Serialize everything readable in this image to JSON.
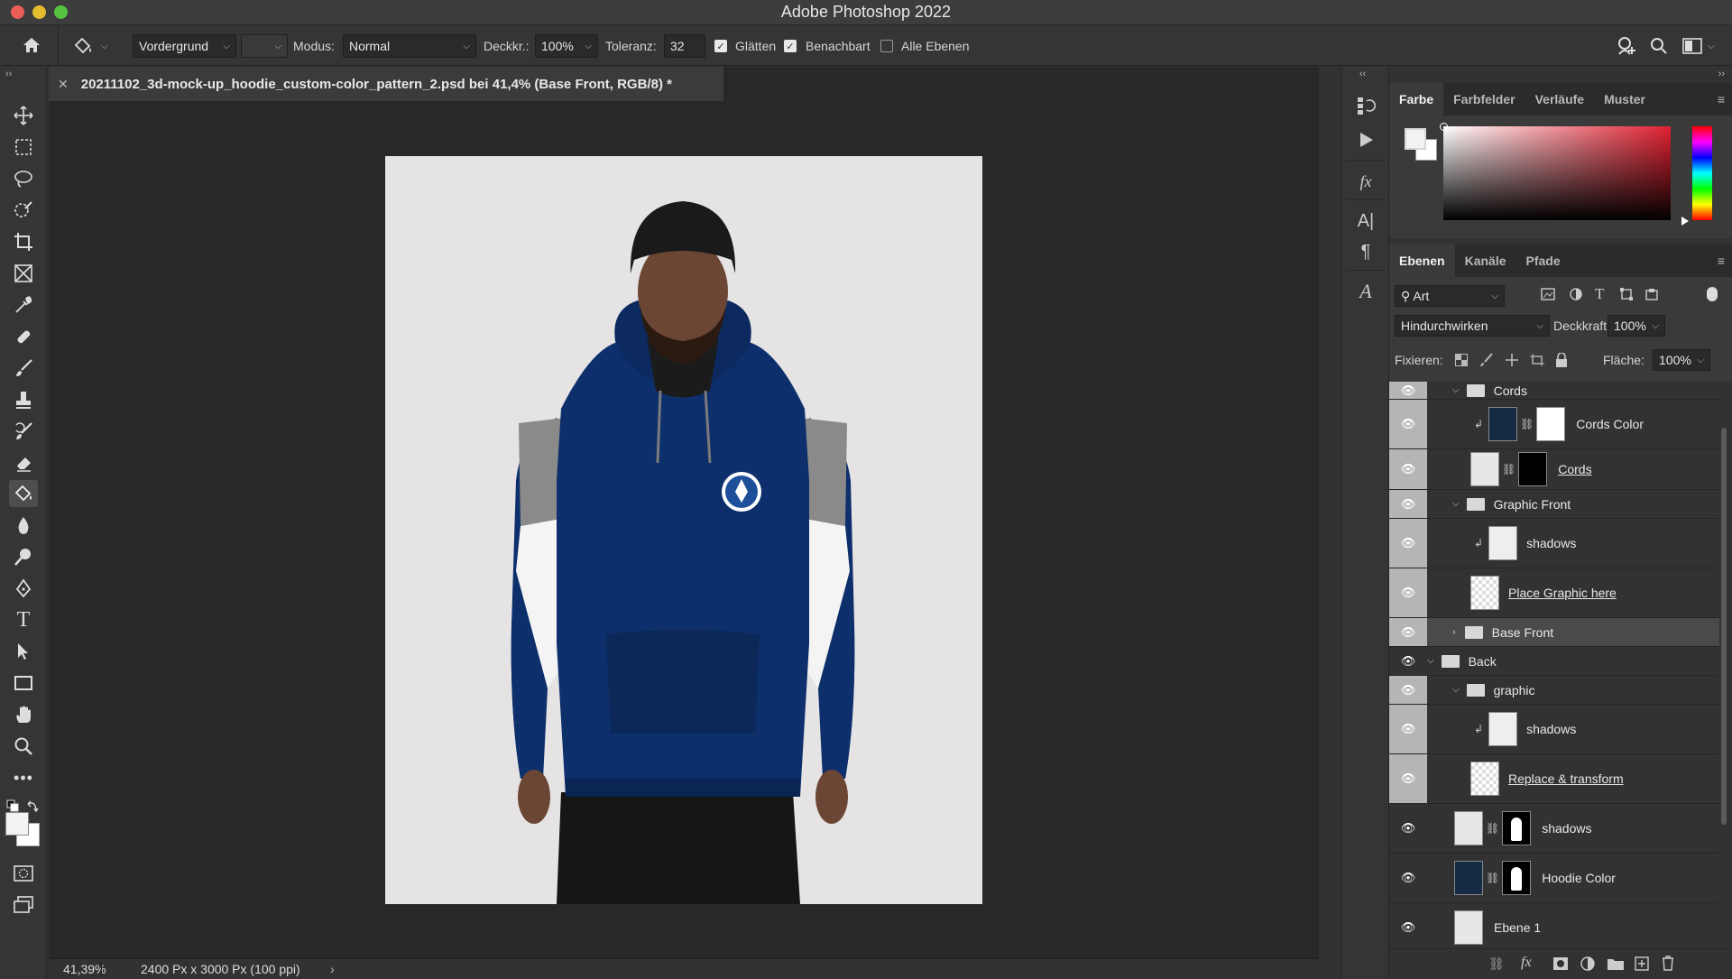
{
  "app": {
    "title": "Adobe Photoshop 2022"
  },
  "options": {
    "fill_source": "Vordergrund",
    "mode_label": "Modus:",
    "mode_value": "Normal",
    "opacity_label": "Deckkr.:",
    "opacity_value": "100%",
    "tolerance_label": "Toleranz:",
    "tolerance_value": "32",
    "antialias_label": "Glätten",
    "contiguous_label": "Benachbart",
    "all_layers_label": "Alle Ebenen"
  },
  "document": {
    "tab_title": "20211102_3d-mock-up_hoodie_custom-color_pattern_2.psd bei 41,4% (Base Front, RGB/8) *"
  },
  "status": {
    "zoom": "41,39%",
    "doc_size": "2400 Px x 3000 Px (100 ppi)"
  },
  "color_panel": {
    "tabs": [
      "Farbe",
      "Farbfelder",
      "Verläufe",
      "Muster"
    ]
  },
  "layers_panel": {
    "tabs": [
      "Ebenen",
      "Kanäle",
      "Pfade"
    ],
    "filter_value": "Art",
    "blend_mode": "Hindurchwirken",
    "opacity_label": "Deckkraft:",
    "opacity_value": "100%",
    "lock_label": "Fixieren:",
    "fill_label": "Fläche:",
    "fill_value": "100%",
    "layers": [
      {
        "name": "Cords",
        "type": "group"
      },
      {
        "name": "Cords Color",
        "type": "fill"
      },
      {
        "name": "Cords",
        "type": "smart"
      },
      {
        "name": "Graphic Front",
        "type": "group"
      },
      {
        "name": "shadows",
        "type": "layer"
      },
      {
        "name": "Place Graphic here",
        "type": "smart"
      },
      {
        "name": "Base Front",
        "type": "group"
      },
      {
        "name": "Back",
        "type": "group"
      },
      {
        "name": "graphic",
        "type": "group"
      },
      {
        "name": "shadows",
        "type": "layer"
      },
      {
        "name": "Replace & transform",
        "type": "smart"
      },
      {
        "name": "shadows",
        "type": "layer"
      },
      {
        "name": "Hoodie Color",
        "type": "fill"
      },
      {
        "name": "Ebene 1",
        "type": "layer"
      }
    ]
  },
  "colors": {
    "accent_orange": "#b8660b",
    "hoodie_navy": "#0d2f6b",
    "panel_bg": "#323232"
  }
}
